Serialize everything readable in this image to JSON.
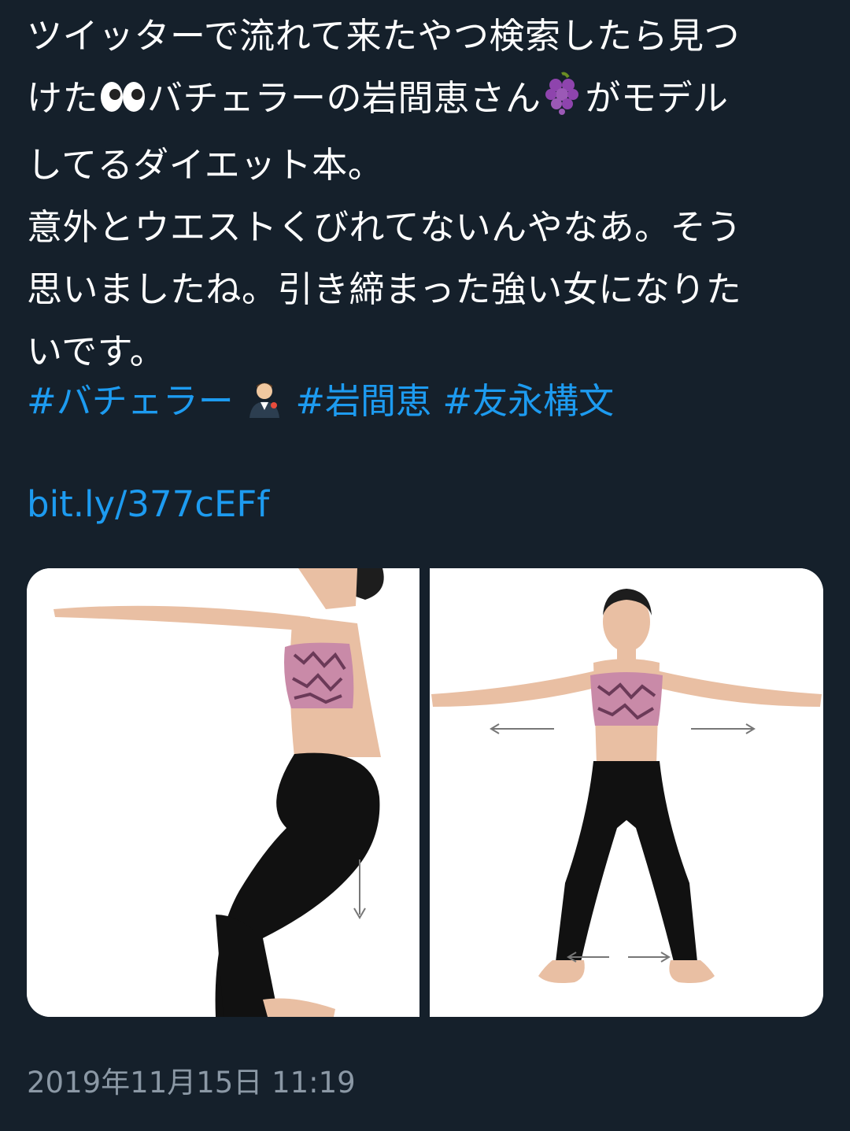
{
  "tweet": {
    "lines": [
      "ツイッターで流れて来たやつ検索したら見つ",
      "けた",
      "バチェラーの岩間恵さん",
      "がモデル",
      "してるダイエット本。",
      "意外とウエストくびれてないんやなあ。そう",
      "思いましたね。引き締まった強い女になりた",
      "いです。"
    ],
    "emojis": [
      "eyes-emoji",
      "grapes-emoji",
      "man-in-tuxedo-emoji"
    ],
    "hashtags": [
      "#バチェラー",
      "#岩間恵",
      "#友永構文"
    ],
    "link": "bit.ly/377cEFf",
    "timestamp": "2019年11月15日 11:19"
  },
  "media": {
    "photos": [
      {
        "description_icon": "squat-photo"
      },
      {
        "description_icon": "standing-stretch-photo"
      }
    ]
  },
  "colors": {
    "background": "#15202b",
    "text": "#ffffff",
    "link": "#1d9bf0",
    "muted": "#8b98a5"
  }
}
